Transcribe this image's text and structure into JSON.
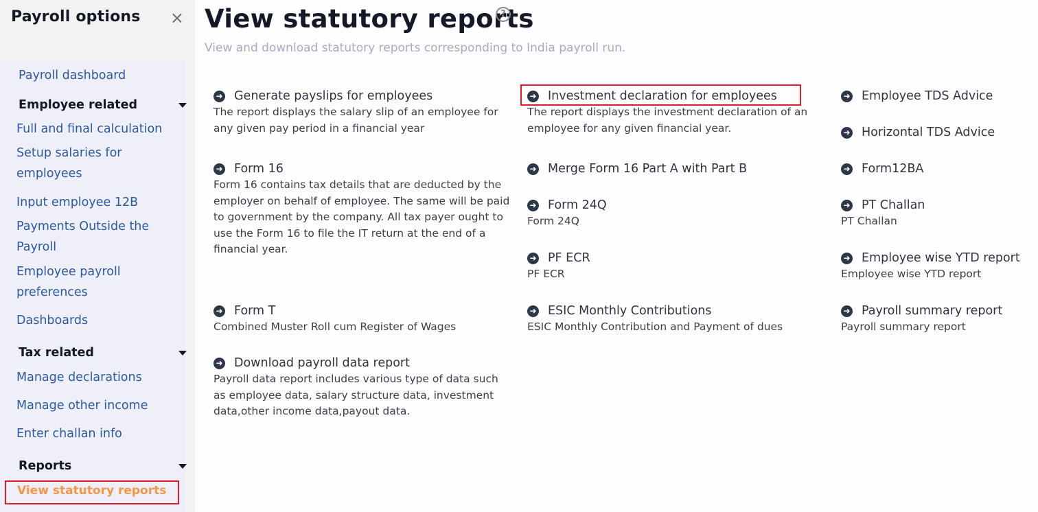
{
  "sidebar": {
    "title": "Payroll options",
    "close_icon": "×",
    "top_link": "Payroll dashboard",
    "groups": [
      {
        "label": "Employee related",
        "items": [
          "Full and final calculation",
          "Setup salaries for employees",
          "Input employee 12B",
          "Payments Outside the Payroll",
          "Employee payroll preferences",
          "Dashboards"
        ]
      },
      {
        "label": "Tax related",
        "items": [
          "Manage declarations",
          "Manage other income",
          "Enter challan info"
        ]
      },
      {
        "label": "Reports",
        "items": [
          "View statutory reports"
        ]
      }
    ],
    "active_item": "View statutory reports"
  },
  "main": {
    "title": "View statutory reports",
    "help_icon": "?",
    "subtitle": "View and download statutory reports corresponding to India payroll run.",
    "arrow_glyph": "➜",
    "reports": [
      {
        "title": "Generate payslips for employees",
        "desc": "The report displays the salary slip of an employee for any given pay period in a financial year"
      },
      {
        "title": "Form 16",
        "desc": "Form 16 contains tax details that are deducted by the employer on behalf of employee. The same will be paid to government by the company. All tax payer ought to use the Form 16 to file the IT return at the end of a financial year."
      },
      {
        "title": "Form T",
        "desc": "Combined Muster Roll cum Register of Wages"
      },
      {
        "title": "Download payroll data report",
        "desc": "Payroll data report includes various type of data such as employee data, salary structure data, investment data,other income data,payout data."
      },
      {
        "title": "Investment declaration for employees",
        "desc": "The report displays the investment declaration of an employee for any given financial year.",
        "highlighted": true
      },
      {
        "title": "Merge Form 16 Part A with Part B",
        "desc": ""
      },
      {
        "title": "Form 24Q",
        "desc": "Form 24Q"
      },
      {
        "title": "PF ECR",
        "desc": "PF ECR"
      },
      {
        "title": "ESIC Monthly Contributions",
        "desc": "ESIC Monthly Contribution and Payment of dues"
      },
      {
        "title": "Employee TDS Advice",
        "desc": ""
      },
      {
        "title": "Horizontal TDS Advice",
        "desc": ""
      },
      {
        "title": "Form12BA",
        "desc": ""
      },
      {
        "title": "PT Challan",
        "desc": "PT Challan"
      },
      {
        "title": "Employee wise YTD report",
        "desc": "Employee wise YTD report"
      },
      {
        "title": "Payroll summary report",
        "desc": "Payroll summary report"
      }
    ]
  },
  "colors": {
    "link": "#2c5aa0",
    "active": "#f4964a",
    "highlight_border": "#e11d2b",
    "arrow_icon_bg": "#2d3748"
  }
}
